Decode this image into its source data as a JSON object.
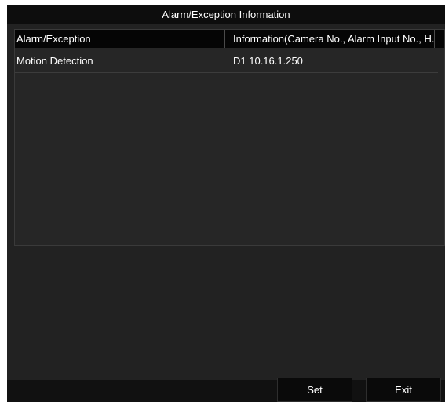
{
  "dialog": {
    "title": "Alarm/Exception Information"
  },
  "table": {
    "columns": [
      "Alarm/Exception",
      "Information(Camera No., Alarm Input No., H..."
    ],
    "rows": [
      {
        "type": "Motion Detection",
        "info": "D1  10.16.1.250"
      }
    ]
  },
  "buttons": {
    "set_label": "Set",
    "exit_label": "Exit"
  },
  "colors": {
    "dialog_bg": "#222222",
    "titlebar_bg": "#0d0d0d",
    "header_bg": "#050505",
    "text": "#ffffff"
  }
}
